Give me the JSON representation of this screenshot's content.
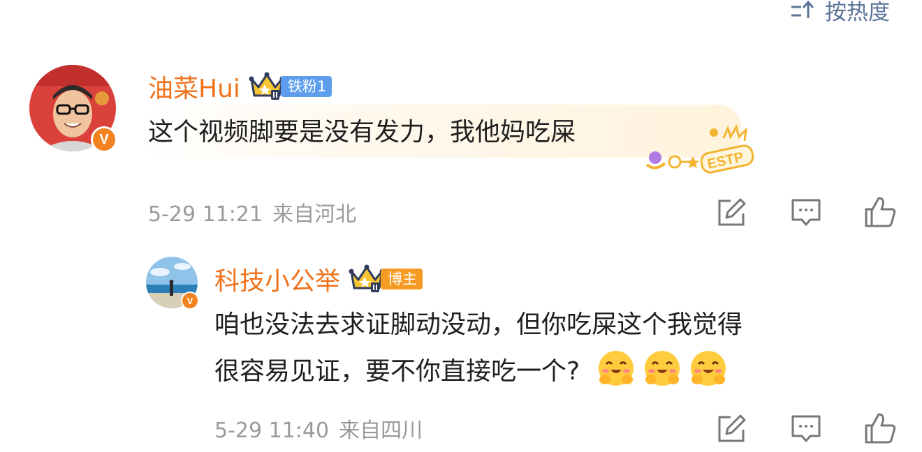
{
  "sort": {
    "label": "按热度",
    "icon": "sort-icon"
  },
  "comments": [
    {
      "user": {
        "name": "油菜Hui",
        "badge_label": "铁粉1",
        "badge_icon": "crown-icon",
        "verified_icon": "verified-v-icon"
      },
      "text": "这个视频脚要是没有发力，我他妈吃屎",
      "decoration_icon": "estp-sticker",
      "meta": {
        "date": "5-29 11:21",
        "location": "来自河北"
      },
      "actions": [
        "share-icon",
        "comment-icon",
        "like-icon"
      ]
    },
    {
      "user": {
        "name": "科技小公举",
        "badge_label": "博主",
        "badge_icon": "crown-icon",
        "verified_icon": "verified-v-icon"
      },
      "text_line1": "咱也没法去求证脚动没动，但你吃屎这个我觉得",
      "text_line2": "很容易见证，要不你直接吃一个?",
      "emojis": [
        "hug-emoji",
        "hug-emoji",
        "hug-emoji"
      ],
      "meta": {
        "date": "5-29 11:40",
        "location": "来自四川"
      },
      "actions": [
        "share-icon",
        "comment-icon",
        "like-icon"
      ]
    }
  ],
  "colors": {
    "username": "#f0731c",
    "meta": "#9a9a9a",
    "sort": "#5b7398",
    "blue_badge": "#5c9ded",
    "orange_badge": "#f59a23"
  },
  "verified_mark": "V"
}
